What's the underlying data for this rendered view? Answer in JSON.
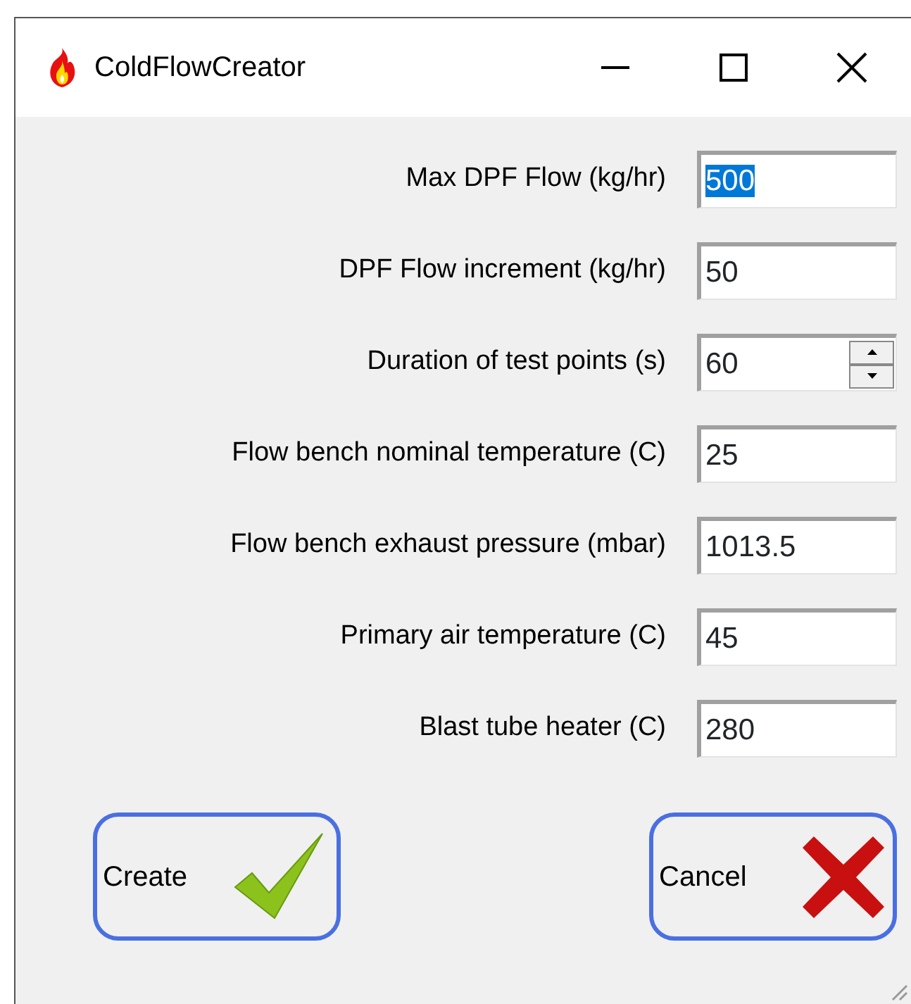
{
  "window": {
    "title": "ColdFlowCreator"
  },
  "fields": [
    {
      "label": "Max DPF Flow (kg/hr)",
      "value": "500",
      "kind": "text",
      "text_selected": true
    },
    {
      "label": "DPF Flow increment (kg/hr)",
      "value": "50",
      "kind": "text",
      "text_selected": false
    },
    {
      "label": "Duration of test points (s)",
      "value": "60",
      "kind": "spinner",
      "text_selected": false
    },
    {
      "label": "Flow bench nominal temperature (C)",
      "value": "25",
      "kind": "text",
      "text_selected": false
    },
    {
      "label": "Flow bench exhaust pressure (mbar)",
      "value": "1013.5",
      "kind": "text",
      "text_selected": false
    },
    {
      "label": "Primary air temperature (C)",
      "value": "45",
      "kind": "text",
      "text_selected": false
    },
    {
      "label": "Blast tube heater (C)",
      "value": "280",
      "kind": "text",
      "text_selected": false
    }
  ],
  "buttons": [
    {
      "label": "Create",
      "kind": "ok"
    },
    {
      "label": "Cancel",
      "kind": "cancel"
    }
  ]
}
